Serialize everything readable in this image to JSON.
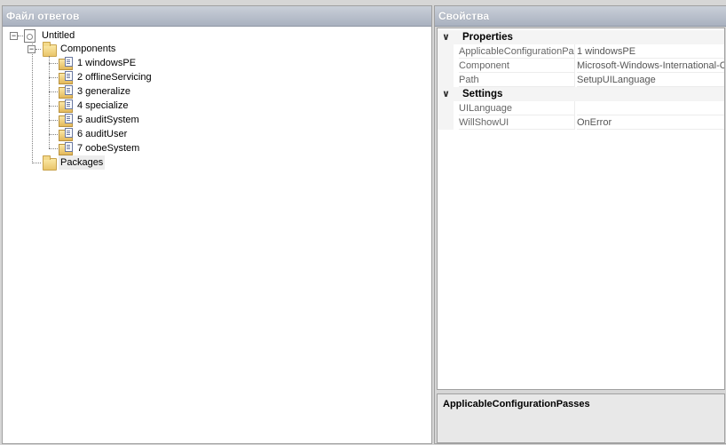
{
  "left_pane": {
    "title": "Файл ответов",
    "root": "Untitled",
    "components": "Components",
    "passes": [
      "1 windowsPE",
      "2 offlineServicing",
      "3 generalize",
      "4 specialize",
      "5 auditSystem",
      "6 auditUser",
      "7 oobeSystem"
    ],
    "packages": "Packages"
  },
  "right_pane": {
    "title": "Свойства",
    "categories": [
      {
        "name": "Properties",
        "rows": [
          {
            "name": "ApplicableConfigurationPasses",
            "value": "1 windowsPE"
          },
          {
            "name": "Component",
            "value": "Microsoft-Windows-International-Core-WinPE"
          },
          {
            "name": "Path",
            "value": "SetupUILanguage"
          }
        ]
      },
      {
        "name": "Settings",
        "rows": [
          {
            "name": "UILanguage",
            "value": ""
          },
          {
            "name": "WillShowUI",
            "value": "OnError"
          }
        ]
      }
    ],
    "description_title": "ApplicableConfigurationPasses"
  }
}
